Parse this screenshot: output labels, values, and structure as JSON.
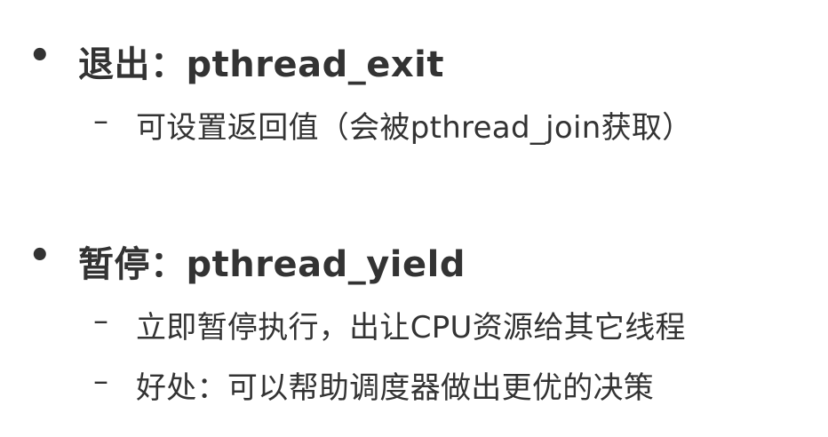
{
  "bullets": [
    {
      "marker": "•",
      "text": "退出：pthread_exit",
      "subitems": [
        {
          "marker": "–",
          "text": "可设置返回值（会被pthread_join获取）"
        }
      ]
    },
    {
      "marker": "•",
      "text": "暂停：pthread_yield",
      "subitems": [
        {
          "marker": "–",
          "text": "立即暂停执行，出让CPU资源给其它线程"
        },
        {
          "marker": "–",
          "text": "好处：可以帮助调度器做出更优的决策"
        }
      ]
    }
  ],
  "colors": {
    "text": "#333333",
    "background": "#ffffff"
  }
}
